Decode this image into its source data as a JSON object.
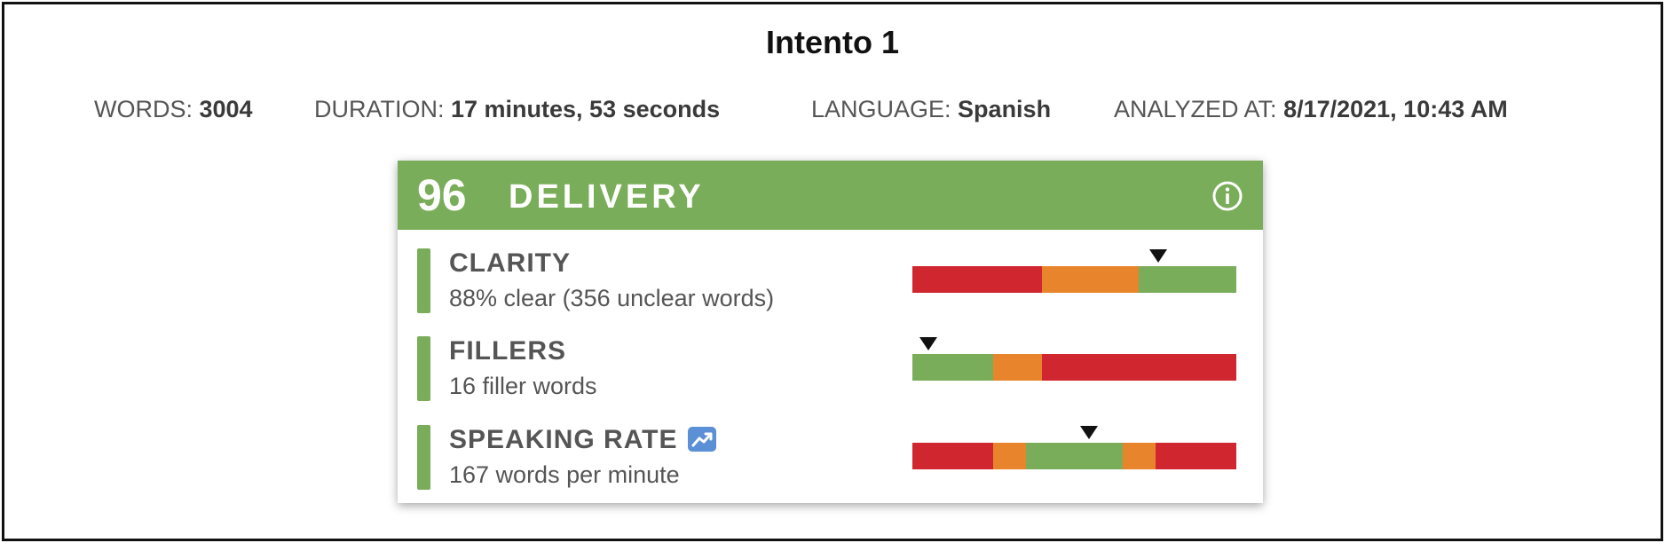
{
  "report": {
    "title": "Intento 1",
    "meta": [
      {
        "label": "WORDS: ",
        "value": "3004"
      },
      {
        "label": "DURATION: ",
        "value": "17 minutes, 53 seconds"
      },
      {
        "label": "LANGUAGE: ",
        "value": "Spanish"
      },
      {
        "label": "ANALYZED AT: ",
        "value": "8/17/2021, 10:43 AM"
      }
    ]
  },
  "delivery": {
    "score": "96",
    "title": "DELIVERY",
    "info_icon": "info-circle-icon",
    "header_color": "#7aad5a",
    "colors": {
      "good": "#7aad5a",
      "warn": "#e8852c",
      "bad": "#d0262f"
    },
    "metrics": [
      {
        "name": "CLARITY",
        "detail": "88% clear (356 unclear words)",
        "scale": [
          {
            "status": "bad",
            "fraction": 0.4
          },
          {
            "status": "warn",
            "fraction": 0.3
          },
          {
            "status": "good",
            "fraction": 0.3
          }
        ],
        "marker_position": 0.76
      },
      {
        "name": "FILLERS",
        "detail": "16 filler words",
        "scale": [
          {
            "status": "good",
            "fraction": 0.25
          },
          {
            "status": "warn",
            "fraction": 0.15
          },
          {
            "status": "bad",
            "fraction": 0.6
          }
        ],
        "marker_position": 0.05
      },
      {
        "name": "SPEAKING RATE",
        "detail": "167 words per minute",
        "trend_icon": "trend-chart-icon",
        "scale": [
          {
            "status": "bad",
            "fraction": 0.25
          },
          {
            "status": "warn",
            "fraction": 0.1
          },
          {
            "status": "good",
            "fraction": 0.3
          },
          {
            "status": "warn",
            "fraction": 0.1
          },
          {
            "status": "bad",
            "fraction": 0.25
          }
        ],
        "marker_position": 0.545
      }
    ]
  }
}
